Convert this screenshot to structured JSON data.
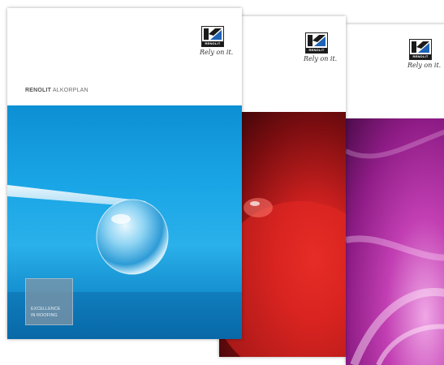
{
  "brochures": [
    {
      "logo": {
        "wordmark": "RENOLIT",
        "tagline": "Rely on it."
      },
      "brand": {
        "company": "RENOLIT",
        "product": "ALKORPLAN"
      },
      "badge_text": "EXCELLENCE\nIN ROOFING",
      "photo_colors": [
        "#0d8fd4",
        "#2ab0ea",
        "#0b74b4"
      ]
    },
    {
      "logo": {
        "wordmark": "RENOLIT",
        "tagline": "Rely on it."
      },
      "photo_colors": [
        "#e8332b",
        "#7a0d10",
        "#2a0406"
      ]
    },
    {
      "logo": {
        "wordmark": "RENOLIT",
        "tagline": "Rely on it."
      },
      "photo_colors": [
        "#f0a6e6",
        "#c23fb3",
        "#4c0b4a"
      ]
    }
  ],
  "logo_colors": {
    "blue": "#1e63b5",
    "black": "#1a1a1a"
  }
}
